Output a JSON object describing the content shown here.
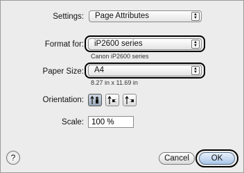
{
  "settings": {
    "label": "Settings:",
    "value": "Page Attributes"
  },
  "format_for": {
    "label": "Format for:",
    "value": "iP2600 series",
    "caption": "Canon iP2600 series"
  },
  "paper_size": {
    "label": "Paper Size:",
    "value": "A4",
    "caption": "8.27 in x 11.69 in"
  },
  "orientation": {
    "label": "Orientation:",
    "options": [
      "portrait-icon",
      "landscape-left-icon",
      "landscape-right-icon"
    ],
    "selected": 0
  },
  "scale": {
    "label": "Scale:",
    "value": "100 %"
  },
  "help": {
    "glyph": "?"
  },
  "buttons": {
    "cancel": "Cancel",
    "ok": "OK"
  },
  "colors": {
    "ring": "#000000",
    "panel": "#ececec",
    "default_button": "#a9c5e8"
  }
}
